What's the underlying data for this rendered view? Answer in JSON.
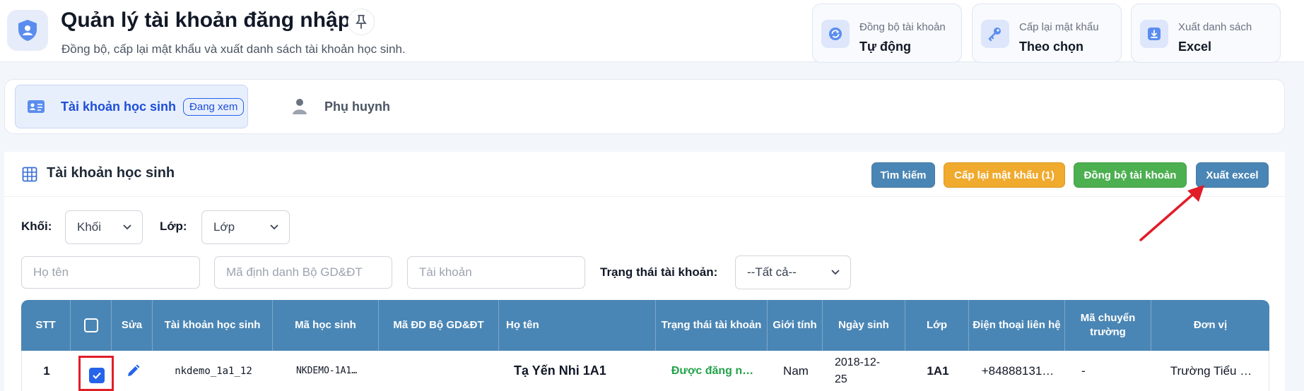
{
  "header": {
    "title": "Quản lý tài khoản đăng nhập",
    "subtitle": "Đồng bộ, cấp lại mật khẩu và xuất danh sách tài khoản học sinh.",
    "icon": "shield-user-icon",
    "pin_icon": "pin-icon"
  },
  "summary_cards": [
    {
      "label": "Đồng bộ tài khoản",
      "value": "Tự động",
      "icon": "sync-icon"
    },
    {
      "label": "Cấp lại mật khẩu",
      "value": "Theo chọn",
      "icon": "key-icon"
    },
    {
      "label": "Xuất danh sách",
      "value": "Excel",
      "icon": "download-icon"
    }
  ],
  "tabs": [
    {
      "label": "Tài khoản học sinh",
      "badge": "Đang xem",
      "active": true,
      "icon": "id-card-icon"
    },
    {
      "label": "Phụ huynh",
      "active": false,
      "icon": "users-icon"
    }
  ],
  "panel": {
    "title": "Tài khoản học sinh",
    "buttons": {
      "search": "Tìm kiếm",
      "reset_password": "Cấp lại mật khẩu (1)",
      "sync": "Đồng bộ tài khoản",
      "export": "Xuất excel"
    }
  },
  "filters": {
    "grade_label": "Khối:",
    "grade_value": "Khối",
    "class_label": "Lớp:",
    "class_value": "Lớp",
    "name_placeholder": "Họ tên",
    "moet_id_placeholder": "Mã định danh Bộ GD&ĐT",
    "account_placeholder": "Tài khoản",
    "status_label": "Trạng thái tài khoản:",
    "status_value": "--Tất cả--"
  },
  "table": {
    "columns": [
      "STT",
      "",
      "Sửa",
      "Tài khoản học sinh",
      "Mã học sinh",
      "Mã ĐD Bộ GD&ĐT",
      "Họ tên",
      "Trạng thái tài khoản",
      "Giới tính",
      "Ngày sinh",
      "Lớp",
      "Điện thoại liên hệ",
      "Mã chuyển trường",
      "Đơn vị"
    ],
    "rows": [
      {
        "stt": "1",
        "checked": true,
        "account": "nkdemo_1a1_12",
        "student_code": "NKDEMO-1A1…",
        "moet_id": "",
        "name": "Tạ Yến Nhi 1A1",
        "status": "Được đăng n…",
        "gender": "Nam",
        "dob": "2018-12-\n25",
        "class": "1A1",
        "phone": "+84888131…",
        "transfer_code": "-",
        "unit": "Trường Tiểu …"
      }
    ]
  },
  "colors": {
    "primary": "#4a86b5",
    "warning": "#f0aa2e",
    "success": "#4caf50",
    "highlight": "#e11d2a"
  }
}
